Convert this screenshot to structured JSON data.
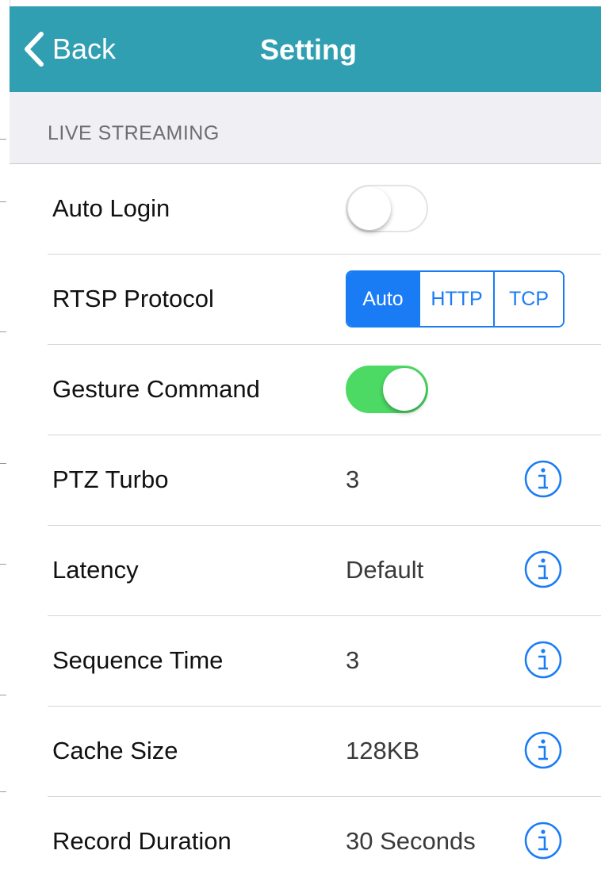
{
  "navbar": {
    "back_label": "Back",
    "title": "Setting",
    "background": "#2f9fb1"
  },
  "section": {
    "header": "LIVE STREAMING"
  },
  "rows": [
    {
      "label": "Auto Login",
      "control": "toggle",
      "toggle_on": false
    },
    {
      "label": "RTSP Protocol",
      "control": "segmented",
      "options": [
        "Auto",
        "HTTP",
        "TCP"
      ],
      "selected": "Auto"
    },
    {
      "label": "Gesture Command",
      "control": "toggle",
      "toggle_on": true
    },
    {
      "label": "PTZ Turbo",
      "value": "3",
      "icon": "info-icon"
    },
    {
      "label": "Latency",
      "value": "Default",
      "icon": "info-icon"
    },
    {
      "label": "Sequence Time",
      "value": "3",
      "icon": "info-icon"
    },
    {
      "label": "Cache Size",
      "value": "128KB",
      "icon": "info-icon"
    },
    {
      "label": "Record Duration",
      "value": "30 Seconds",
      "icon": "info-icon"
    }
  ],
  "colors": {
    "accent_blue": "#1a7cf5",
    "toggle_on_green": "#4cd964",
    "section_background": "#efeff4"
  }
}
